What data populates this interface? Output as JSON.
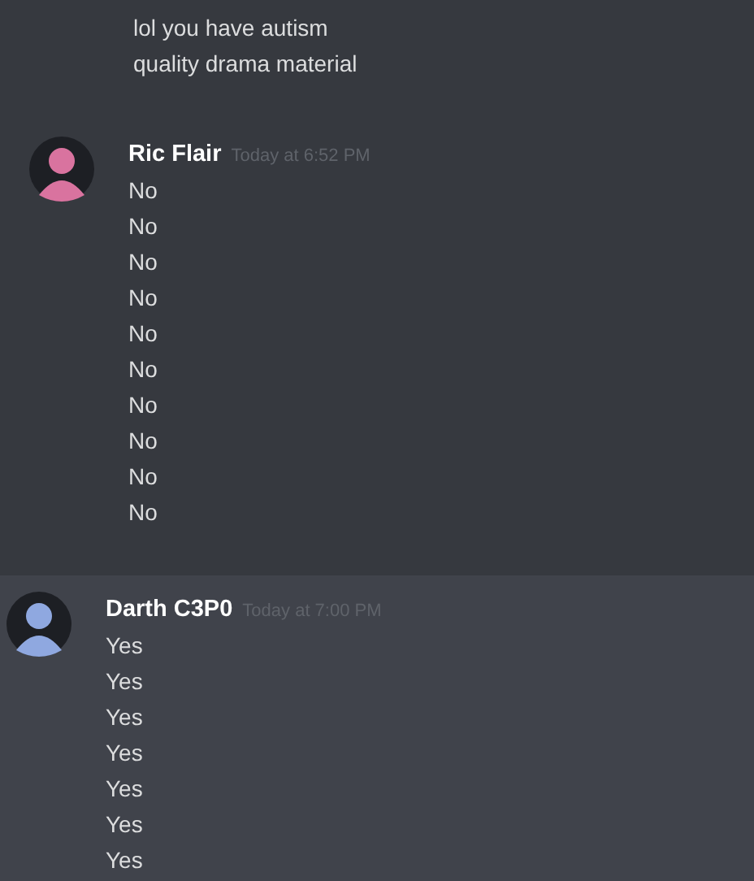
{
  "groups": [
    {
      "kind": "cut",
      "highlighted": false,
      "lines": [
        "lol you have autism",
        "quality drama material"
      ]
    },
    {
      "kind": "full",
      "author": "Ric Flair",
      "timestamp": "Today at 6:52 PM",
      "highlighted": false,
      "lines": [
        "No",
        "No",
        "No",
        "No",
        "No",
        "No",
        "No",
        "No",
        "No",
        "No"
      ]
    },
    {
      "kind": "full",
      "author": "Darth C3P0",
      "timestamp": "Today at 7:00 PM",
      "highlighted": true,
      "lines": [
        "Yes",
        "Yes",
        "Yes",
        "Yes",
        "Yes",
        "Yes",
        "Yes"
      ]
    }
  ]
}
